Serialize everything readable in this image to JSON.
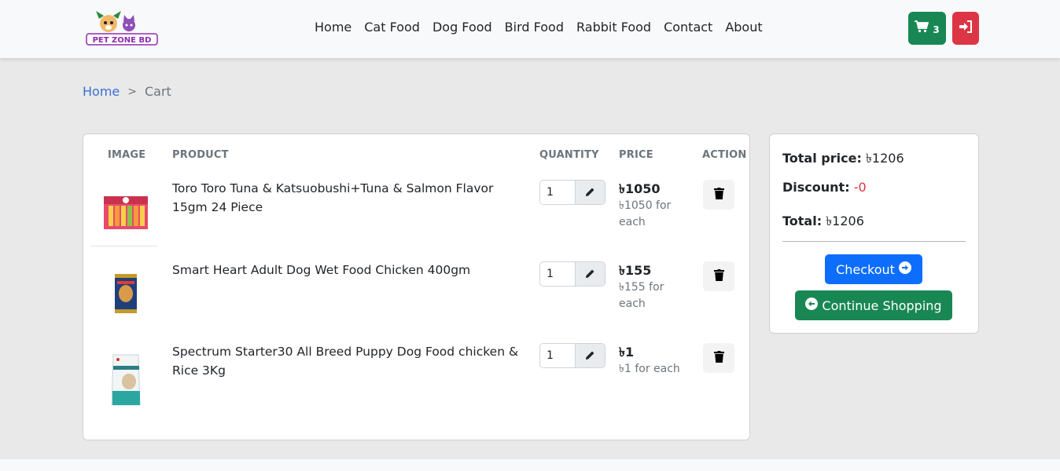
{
  "header": {
    "logo_text": "PET ZONE BD",
    "nav": [
      "Home",
      "Cat Food",
      "Dog Food",
      "Bird Food",
      "Rabbit Food",
      "Contact",
      "About"
    ],
    "cart_count": "3",
    "colors": {
      "cart_button": "#198754",
      "login_button": "#dc3545"
    }
  },
  "breadcrumb": {
    "home": "Home",
    "separator": ">",
    "current": "Cart"
  },
  "table": {
    "headers": {
      "image": "IMAGE",
      "product": "PRODUCT",
      "quantity": "QUANTITY",
      "price": "PRICE",
      "action": "ACTION"
    },
    "rows": [
      {
        "name": "Toro Toro Tuna & Katsuobushi+Tuna & Salmon Flavor 15gm 24 Piece",
        "quantity": "1",
        "price": "৳1050",
        "price_each": "৳1050 for each",
        "image_icon": "cat-treat-pack-image"
      },
      {
        "name": "Smart Heart Adult Dog Wet Food Chicken 400gm",
        "quantity": "1",
        "price": "৳155",
        "price_each": "৳155 for each",
        "image_icon": "dog-food-can-image"
      },
      {
        "name": "Spectrum Starter30 All Breed Puppy Dog Food chicken & Rice 3Kg",
        "quantity": "1",
        "price": "৳1",
        "price_each": "৳1 for each",
        "image_icon": "puppy-food-bag-image"
      }
    ]
  },
  "summary": {
    "total_price_label": "Total price:",
    "total_price_value": "৳1206",
    "discount_label": "Discount:",
    "discount_value": "-0",
    "total_label": "Total:",
    "total_value": "৳1206",
    "checkout_label": "Checkout",
    "continue_label": "Continue Shopping",
    "colors": {
      "checkout": "#0d6efd",
      "continue": "#198754",
      "discount": "#dc3545"
    }
  }
}
